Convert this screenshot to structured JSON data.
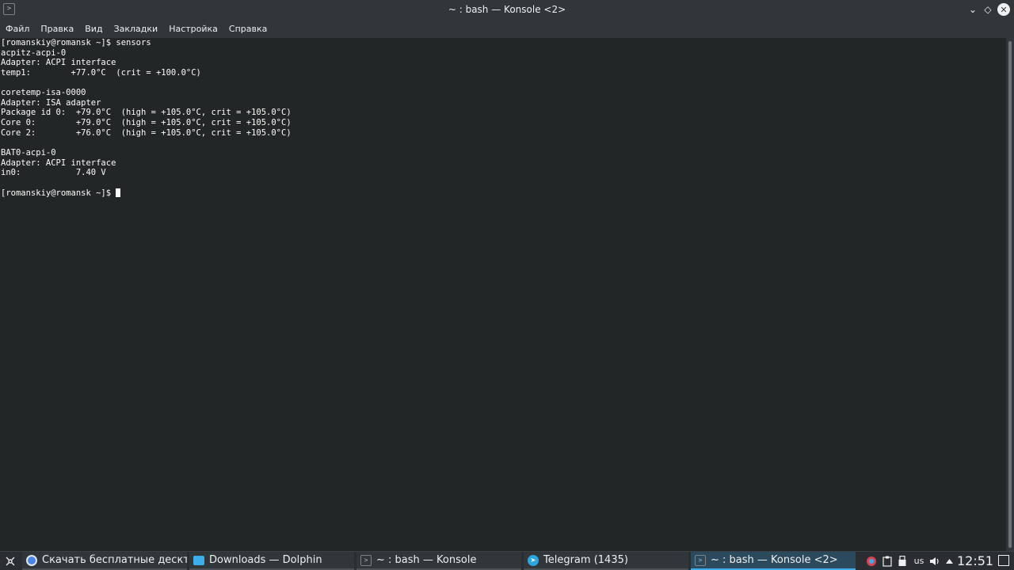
{
  "window": {
    "title": "~ : bash — Konsole <2>",
    "app_icon": ">",
    "buttons": {
      "minimize": "⌄",
      "keep_above": "◇",
      "maximize": "⌃",
      "close": "✕"
    }
  },
  "menubar": {
    "items": [
      "Файл",
      "Правка",
      "Вид",
      "Закладки",
      "Настройка",
      "Справка"
    ]
  },
  "terminal": {
    "lines": [
      "[romanskiy@romansk ~]$ sensors",
      "acpitz-acpi-0",
      "Adapter: ACPI interface",
      "temp1:        +77.0°C  (crit = +100.0°C)",
      "",
      "coretemp-isa-0000",
      "Adapter: ISA adapter",
      "Package id 0:  +79.0°C  (high = +105.0°C, crit = +105.0°C)",
      "Core 0:        +79.0°C  (high = +105.0°C, crit = +105.0°C)",
      "Core 2:        +76.0°C  (high = +105.0°C, crit = +105.0°C)",
      "",
      "BAT0-acpi-0",
      "Adapter: ACPI interface",
      "in0:           7.40 V",
      "",
      "[romanskiy@romansk ~]$ "
    ]
  },
  "taskbar": {
    "launcher_icon": "application-launcher-icon",
    "tasks": [
      {
        "label": "Скачать бесплатные дескто...",
        "icon": "chrome-icon"
      },
      {
        "label": "Downloads — Dolphin",
        "icon": "folder-icon"
      },
      {
        "label": "~ : bash — Konsole",
        "icon": "konsole-icon"
      },
      {
        "label": "Telegram (1435)",
        "icon": "telegram-icon"
      },
      {
        "label": "~ : bash — Konsole <2>",
        "icon": "konsole-icon",
        "active": true
      }
    ],
    "tray": {
      "keyboard_layout": "us",
      "clock": "12:51"
    }
  },
  "colors": {
    "terminal_bg": "#232627",
    "chrome_bg": "#31363b",
    "accent": "#3daee9"
  }
}
